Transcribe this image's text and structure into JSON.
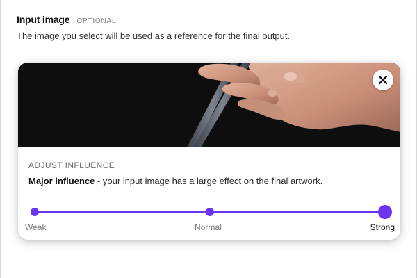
{
  "section": {
    "title": "Input image",
    "optional_tag": "OPTIONAL",
    "description": "The image you select will be used as a reference for the final output."
  },
  "preview": {
    "subject_icon": "hand-holding-chopsticks-photo",
    "remove_icon": "close-icon"
  },
  "influence": {
    "heading": "ADJUST INFLUENCE",
    "level_name": "Major influence",
    "level_description": " - your input image has a large effect on the final artwork.",
    "slider": {
      "stops": [
        "Weak",
        "Normal",
        "Strong"
      ],
      "selected": "Strong",
      "value_fraction": 1.0
    }
  },
  "colors": {
    "accent": "#6a35f0",
    "preview_background": "#0e0e0f"
  }
}
